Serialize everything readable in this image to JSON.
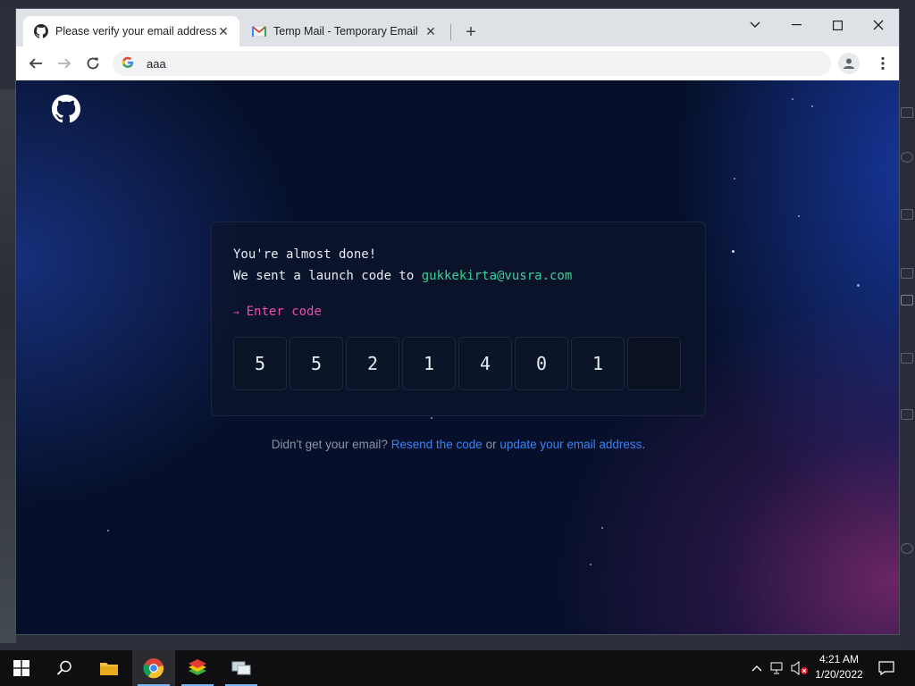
{
  "browser": {
    "tabs": [
      {
        "title": "Please verify your email address",
        "favicon": "github-icon",
        "active": true
      },
      {
        "title": "Temp Mail - Temporary Email",
        "favicon": "gmail-envelope-icon",
        "active": false
      }
    ],
    "address_bar": {
      "value": "aaa",
      "search_engine_icon": "google-g-icon"
    }
  },
  "page": {
    "card": {
      "line1": "You're almost done!",
      "line2_prefix": "We sent a launch code to ",
      "email": "gukkekirta@vusra.com",
      "prompt_arrow": "→",
      "prompt_label": "Enter code",
      "code_digits": [
        "5",
        "5",
        "2",
        "1",
        "4",
        "0",
        "1",
        ""
      ]
    },
    "footer": {
      "prefix": "Didn't get your email?",
      "resend_link": "Resend the code",
      "middle": "or",
      "update_link": "update your email address",
      "suffix": "."
    },
    "colors": {
      "email": "#34d399",
      "prompt": "#ea4aaa",
      "link": "#3b82f6",
      "muted": "#8b949e"
    }
  },
  "taskbar": {
    "apps": [
      "start-icon",
      "search-icon",
      "file-explorer-icon",
      "chrome-icon",
      "bluestacks-icon",
      "network-app-icon"
    ],
    "clock_time": "4:21 AM",
    "clock_date": "1/20/2022"
  }
}
